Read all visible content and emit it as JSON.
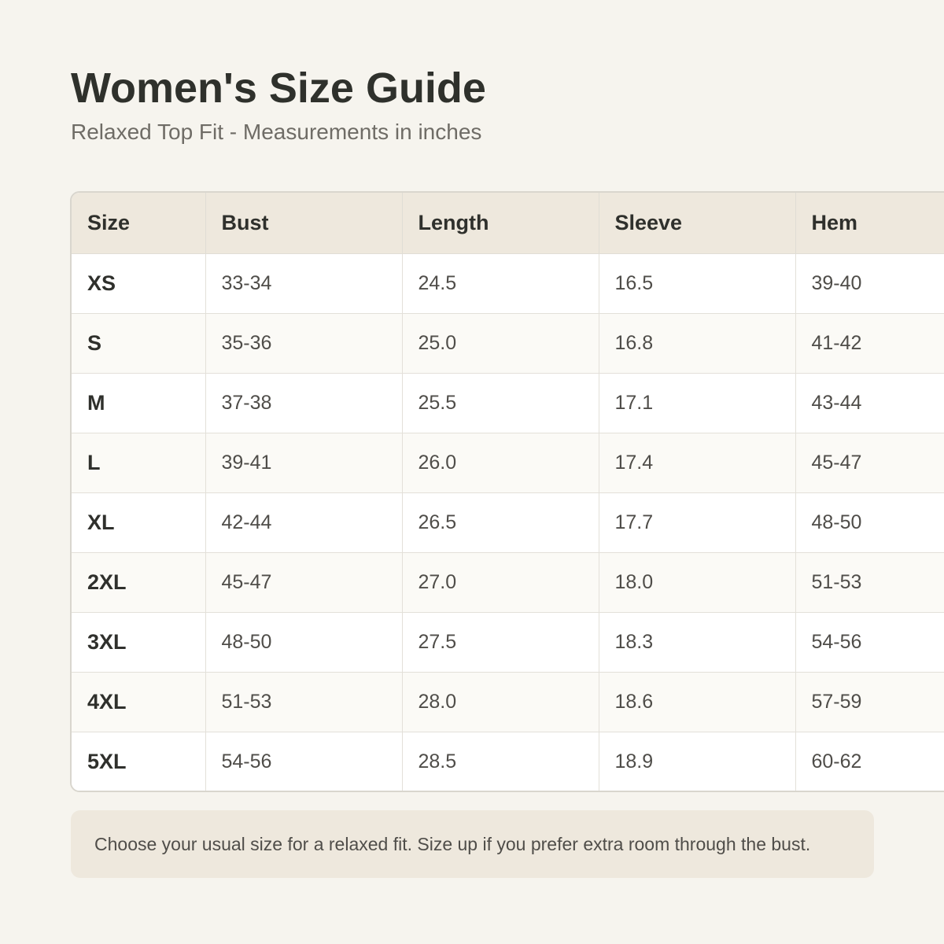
{
  "header": {
    "title": "Women's Size Guide",
    "subtitle": "Relaxed Top Fit - Measurements in inches"
  },
  "table": {
    "columns": [
      "Size",
      "Bust",
      "Length",
      "Sleeve",
      "Hem"
    ],
    "rows": [
      [
        "XS",
        "33-34",
        "24.5",
        "16.5",
        "39-40"
      ],
      [
        "S",
        "35-36",
        "25.0",
        "16.8",
        "41-42"
      ],
      [
        "M",
        "37-38",
        "25.5",
        "17.1",
        "43-44"
      ],
      [
        "L",
        "39-41",
        "26.0",
        "17.4",
        "45-47"
      ],
      [
        "XL",
        "42-44",
        "26.5",
        "17.7",
        "48-50"
      ],
      [
        "2XL",
        "45-47",
        "27.0",
        "18.0",
        "51-53"
      ],
      [
        "3XL",
        "48-50",
        "27.5",
        "18.3",
        "54-56"
      ],
      [
        "4XL",
        "51-53",
        "28.0",
        "18.6",
        "57-59"
      ],
      [
        "5XL",
        "54-56",
        "28.5",
        "18.9",
        "60-62"
      ]
    ]
  },
  "note": {
    "text": "Choose your usual size for a relaxed fit. Size up if you prefer extra room through the bust."
  },
  "colors": {
    "background": "#f6f4ee",
    "header_row": "#eee8dd",
    "text_dark": "#2f302c",
    "text_muted": "#6f6c66"
  }
}
